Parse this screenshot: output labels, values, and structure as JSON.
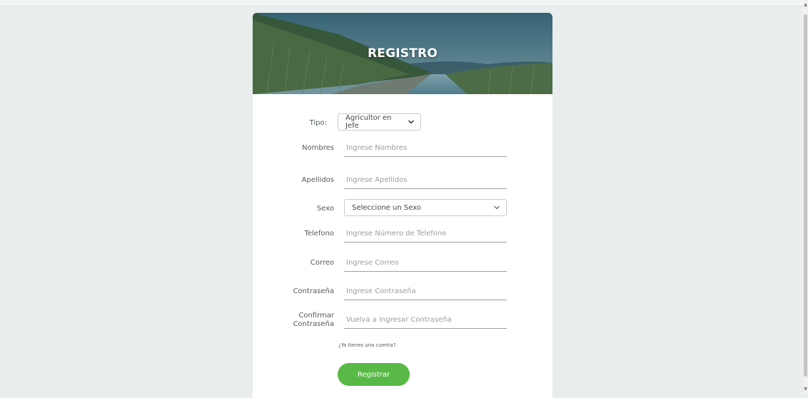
{
  "form": {
    "title": "REGISTRO",
    "fields": {
      "tipo": {
        "label": "Tipo:",
        "value": "Agricultor en Jefe"
      },
      "nombres": {
        "label": "Nombres",
        "placeholder": "Ingrese Nombres"
      },
      "apellidos": {
        "label": "Apellidos",
        "placeholder": "Ingrese Apellidos"
      },
      "sexo": {
        "label": "Sexo",
        "value": "Seleccione un Sexo"
      },
      "telefono": {
        "label": "Telefono",
        "placeholder": "Ingrese Número de Telefono"
      },
      "correo": {
        "label": "Correo",
        "placeholder": "Ingrese Correo"
      },
      "contrasena": {
        "label": "Contraseña",
        "placeholder": "Ingrese Contraseña"
      },
      "confirmar": {
        "label_line1": "Confirmar",
        "label_line2": "Contraseña",
        "placeholder": "Vuelva a Ingresar Contraseña"
      }
    },
    "login_link": "¿Ya tienes una cuenta?",
    "submit_label": "Registrar"
  },
  "icons": {
    "select_arrow": "chevron-down-icon",
    "scroll_up": "scroll-up-arrow-icon",
    "scroll_down": "scroll-down-arrow-icon"
  },
  "colors": {
    "page_background": "#e9eded",
    "card_background": "#ffffff",
    "button": "#58b946",
    "banner_sky": "#4a7a8a",
    "banner_crop": "#4d6b3a"
  }
}
